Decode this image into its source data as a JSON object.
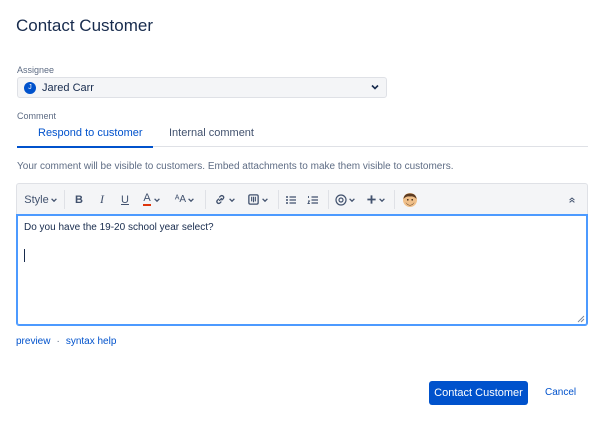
{
  "dialog": {
    "title": "Contact Customer"
  },
  "assignee": {
    "label": "Assignee",
    "value": "Jared Carr",
    "avatar_initial": "J"
  },
  "comment": {
    "label": "Comment",
    "tabs": [
      {
        "label": "Respond to customer",
        "active": true
      },
      {
        "label": "Internal comment",
        "active": false
      }
    ],
    "visibility_note": "Your comment will be visible to customers. Embed attachments to make them visible to customers."
  },
  "toolbar": {
    "style_label": "Style",
    "bold_label": "B",
    "italic_label": "I",
    "underline_label": "U",
    "text_color_label": "A",
    "more_format_label": "ᴬA",
    "icons": [
      "link-icon",
      "attachment-icon",
      "bullet-list-icon",
      "numbered-list-icon",
      "mention-icon",
      "insert-plus-icon",
      "emoji-avatar-icon",
      "collapse-icon"
    ]
  },
  "editor": {
    "content": "Do you have the 19-20 school year select?"
  },
  "links": {
    "preview": "preview",
    "separator": "·",
    "syntax_help": "syntax help"
  },
  "actions": {
    "submit_label": "Contact Customer",
    "cancel_label": "Cancel"
  },
  "colors": {
    "primary": "#0052cc",
    "text": "#172b4d",
    "subtle": "#5e6c84",
    "focus": "#4c9aff",
    "text_color_underline": "#de350b"
  }
}
